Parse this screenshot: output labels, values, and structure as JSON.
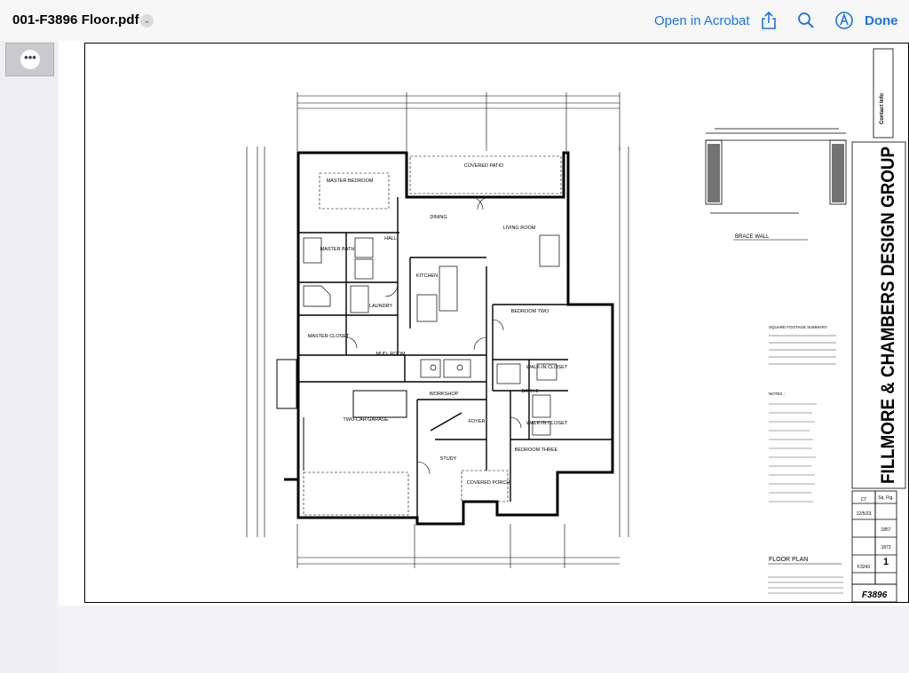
{
  "toolbar": {
    "title": "001-F3896 Floor.pdf",
    "open_in_acrobat": "Open in Acrobat",
    "done": "Done",
    "share_icon": "share-icon",
    "search_icon": "search-icon",
    "markup_icon": "markup-icon",
    "accent": "#1a73e8"
  },
  "sidebar": {
    "page_thumb_menu": "•••"
  },
  "plan": {
    "rooms": {
      "master_bedroom": "MASTER BEDROOM",
      "covered_patio": "COVERED PATIO",
      "dining": "DINING",
      "living_room": "LIVING ROOM",
      "hall": "HALL",
      "master_bath": "MASTER BATH",
      "kitchen": "KITCHEN",
      "laundry": "LAUNDRY",
      "bedroom_two": "BEDROOM TWO",
      "master_closet": "MASTER CLOSET",
      "mud_room": "MUD- ROOM",
      "walk_in_closet": "WALK-IN CLOSET",
      "workshop": "WORKSHOP",
      "bath_2": "BATH 2",
      "two_car_garage": "TWO-CAR GARAGE",
      "foyer": "FOYER",
      "study": "STUDY",
      "bedroom_three": "BEDROOM THREE",
      "covered_porch": "COVERED PORCH"
    },
    "brace_wall": "BRACE WALL",
    "square_footage_summary": "SQUARE FOOTAGE SUMMARY",
    "notes": "NOTES :",
    "floor_plan": "FLOOR PLAN",
    "firm_name": "FILLMORE & CHAMBERS DESIGN GROUP",
    "contact_info": "Contact Info",
    "plan_number": "F3896",
    "title_block": {
      "drawn_by_value": "CT",
      "date_value": "12/5/23",
      "sq_ftg": "Sq. Ftg.",
      "total_value_a": "1857",
      "total_value_b": "1873",
      "sheet_number": "1",
      "reference_value": "F3243"
    }
  }
}
